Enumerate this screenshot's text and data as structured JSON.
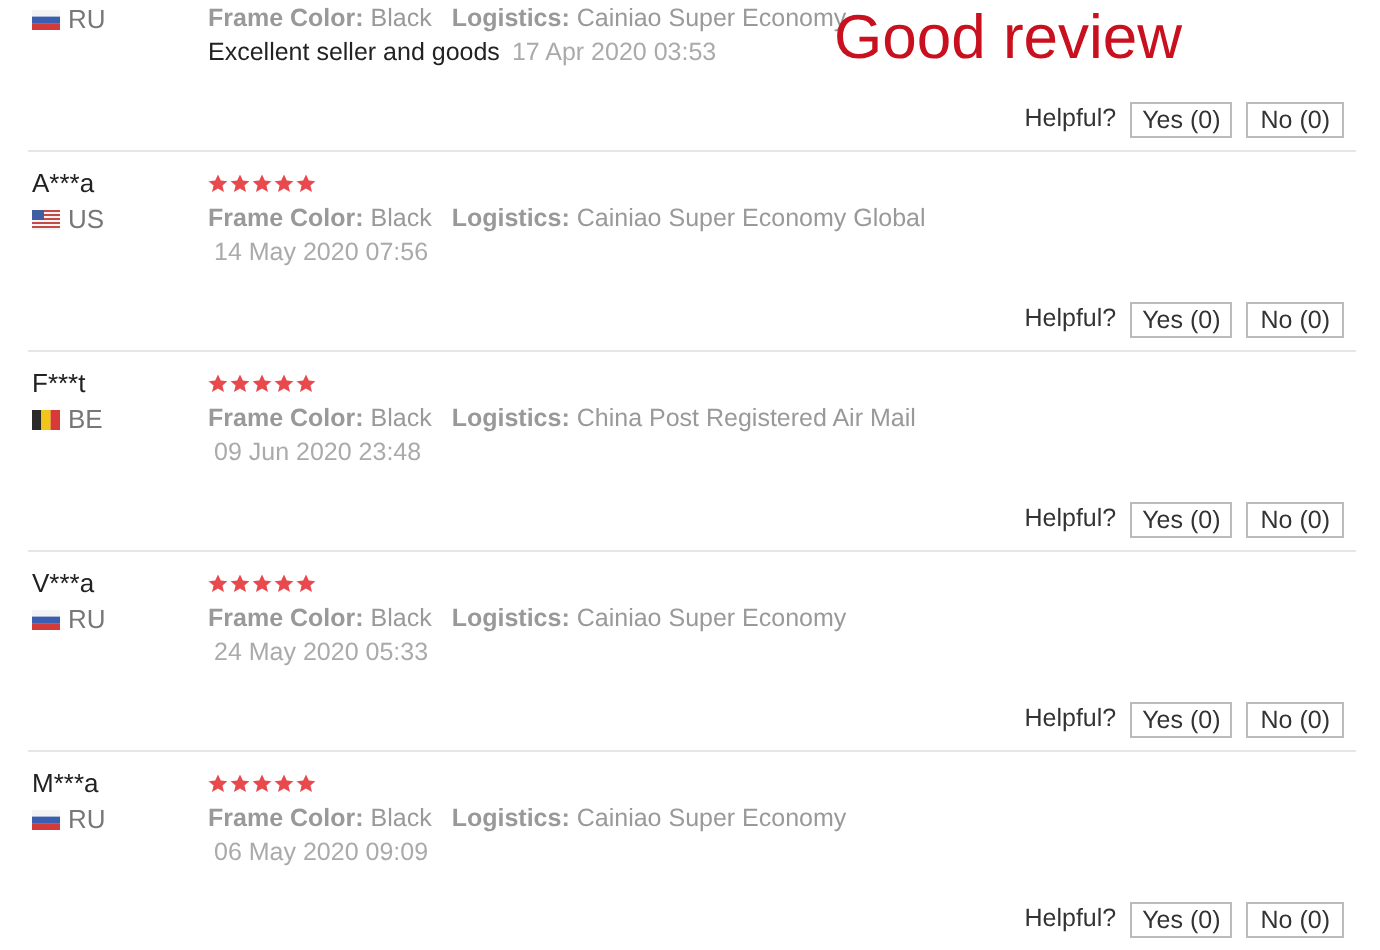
{
  "annotation": "Good review",
  "reviews": [
    {
      "country": "RU",
      "flag": {
        "kind": "horizontal"
      },
      "frame_color_label": "Frame Color:",
      "frame_color": "Black",
      "logistics_label": "Logistics:",
      "logistics": "Cainiao Super Economy",
      "comment": "Excellent seller and goods",
      "date": "17 Apr 2020 03:53",
      "helpful_label": "Helpful?",
      "yes": "Yes (0)",
      "no": "No (0)"
    },
    {
      "name": "A***a",
      "stars": 5,
      "country": "US",
      "flag": {
        "kind": "stripes"
      },
      "frame_color_label": "Frame Color:",
      "frame_color": "Black",
      "logistics_label": "Logistics:",
      "logistics": "Cainiao Super Economy Global",
      "date": "14 May 2020 07:56",
      "helpful_label": "Helpful?",
      "yes": "Yes (0)",
      "no": "No (0)"
    },
    {
      "name": "F***t",
      "stars": 5,
      "country": "BE",
      "flag": {
        "kind": "vertical"
      },
      "frame_color_label": "Frame Color:",
      "frame_color": "Black",
      "logistics_label": "Logistics:",
      "logistics": "China Post Registered Air Mail",
      "date": "09 Jun 2020 23:48",
      "helpful_label": "Helpful?",
      "yes": "Yes (0)",
      "no": "No (0)"
    },
    {
      "name": "V***a",
      "stars": 5,
      "country": "RU",
      "flag": {
        "kind": "horizontal"
      },
      "frame_color_label": "Frame Color:",
      "frame_color": "Black",
      "logistics_label": "Logistics:",
      "logistics": "Cainiao Super Economy",
      "date": "24 May 2020 05:33",
      "helpful_label": "Helpful?",
      "yes": "Yes (0)",
      "no": "No (0)"
    },
    {
      "name": "M***a",
      "stars": 5,
      "country": "RU",
      "flag": {
        "kind": "horizontal"
      },
      "frame_color_label": "Frame Color:",
      "frame_color": "Black",
      "logistics_label": "Logistics:",
      "logistics": "Cainiao Super Economy",
      "date": "06 May 2020 09:09",
      "helpful_label": "Helpful?",
      "yes": "Yes (0)",
      "no": "No (0)"
    }
  ]
}
